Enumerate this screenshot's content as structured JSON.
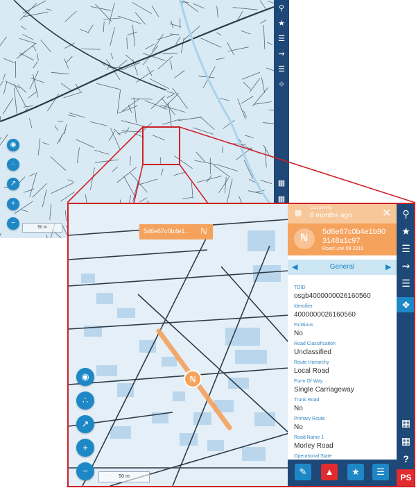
{
  "colors": {
    "navy": "#1e4877",
    "accent_orange": "#f5a25d",
    "button_blue": "#1e88c7",
    "highlight_red": "#cf2027",
    "label_blue": "#3a88c2"
  },
  "background_sidebar_icons": [
    "search-icon",
    "star-icon",
    "layers-icon",
    "route-icon",
    "layers-stack-icon",
    "tag-icon",
    "table-icon",
    "folder-icon"
  ],
  "background_scale": "50 m",
  "popup": {
    "id": "5d6e67c0b4e1...",
    "icon": "road-link-icon"
  },
  "panel": {
    "last_activity_label": "Last activity",
    "last_activity_value": "8 months ago",
    "title_line1": "5d6e67c0b4e1b90",
    "title_line2": "3148a1c97",
    "subtitle": "Road Link 09-2019",
    "tab": "General",
    "fields": [
      {
        "label": "TOID",
        "value": "osgb4000000026160560"
      },
      {
        "label": "Identifier",
        "value": "4000000026160560"
      },
      {
        "label": "Fictitious",
        "value": "No"
      },
      {
        "label": "Road Classification",
        "value": "Unclassified"
      },
      {
        "label": "Route Hierarchy",
        "value": "Local Road"
      },
      {
        "label": "Form Of Way",
        "value": "Single Carriageway"
      },
      {
        "label": "Trunk Road",
        "value": "No"
      },
      {
        "label": "Primary Route",
        "value": "No"
      },
      {
        "label": "Road Name 1",
        "value": "Morley Road"
      },
      {
        "label": "Operational State",
        "value": ""
      }
    ]
  },
  "inset_scale": "50 m",
  "ps_badge": "PS"
}
